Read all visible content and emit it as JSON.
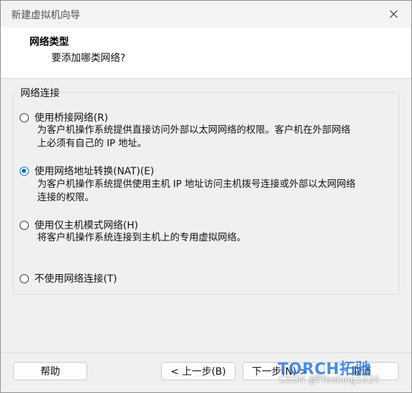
{
  "window": {
    "title": "新建虚拟机向导"
  },
  "header": {
    "title": "网络类型",
    "subtitle": "要添加哪类网络?"
  },
  "group": {
    "legend": "网络连接"
  },
  "options": [
    {
      "label": "使用桥接网络(R)",
      "checked": false,
      "desc_lines": [
        "为客户机操作系统提供直接访问外部以太网网络的权限。客户机在外部网络",
        "上必须有自己的 IP 地址。"
      ]
    },
    {
      "label": "使用网络地址转换(NAT)(E)",
      "checked": true,
      "desc_lines": [
        "为客户机操作系统提供使用主机 IP 地址访问主机拨号连接或外部以太网网络",
        "连接的权限。"
      ]
    },
    {
      "label": "使用仅主机模式网络(H)",
      "checked": false,
      "desc_lines": [
        "将客户机操作系统连接到主机上的专用虚拟网络。"
      ]
    },
    {
      "label": "不使用网络连接(T)",
      "checked": false,
      "desc_lines": []
    }
  ],
  "buttons": {
    "help": "帮助",
    "back": "< 上一步(B)",
    "next": "下一步(N) >",
    "cancel": "取消"
  },
  "watermark": {
    "logo": "TORCH拓驰",
    "csdn": "CSDN @Freeking1024"
  },
  "colors": {
    "accent": "#0067c0",
    "window_bg": "#f0f0f0",
    "header_bg": "#ffffff"
  }
}
